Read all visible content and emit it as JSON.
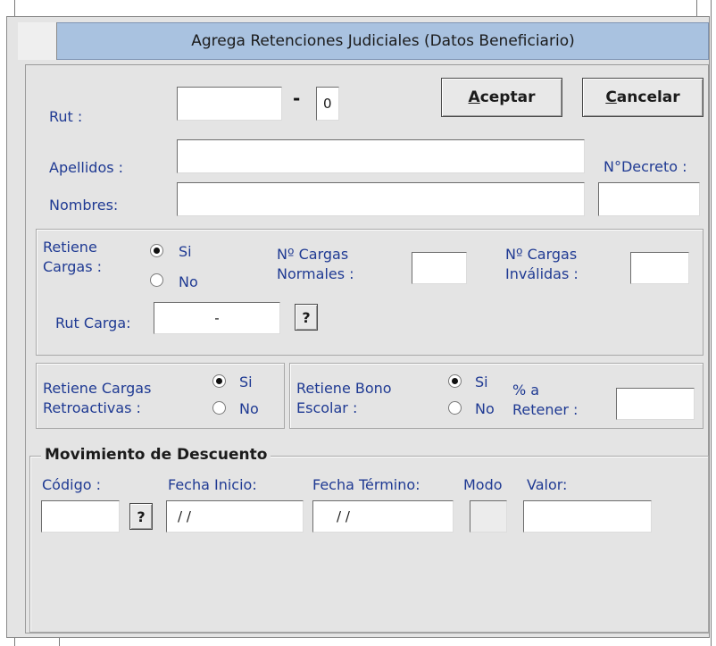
{
  "window": {
    "title": "Agrega Retenciones Judiciales (Datos Beneficiario)"
  },
  "form": {
    "rut_label": "Rut :",
    "rut_value": "",
    "rut_dash": "-",
    "rut_dv": "0",
    "apellidos_label": "Apellidos :",
    "apellidos_value": "",
    "nombres_label": "Nombres:",
    "nombres_value": "",
    "decreto_label": "N°Decreto :",
    "decreto_value": ""
  },
  "buttons": {
    "aceptar_mnemonic": "A",
    "aceptar_rest": "ceptar",
    "cancelar_mnemonic": "C",
    "cancelar_rest": "ancelar",
    "help": "?"
  },
  "cargas": {
    "retiene_label_1": "Retiene",
    "retiene_label_2": "Cargas :",
    "si_label": "Si",
    "no_label": "No",
    "normales_label_1": "Nº Cargas",
    "normales_label_2": "Normales :",
    "normales_value": "",
    "invalidas_label_1": "Nº Cargas",
    "invalidas_label_2": "Inválidas :",
    "invalidas_value": "",
    "rut_carga_label": "Rut Carga:",
    "rut_carga_value": "-"
  },
  "retroactivas": {
    "label_1": "Retiene Cargas",
    "label_2": "Retroactivas :",
    "si_label": "Si",
    "no_label": "No"
  },
  "bono": {
    "label_1": "Retiene Bono",
    "label_2": "Escolar  :",
    "si_label": "Si",
    "no_label": "No",
    "pct_label_1": "% a",
    "pct_label_2": "Retener :",
    "pct_value": ""
  },
  "movimiento": {
    "legend": "Movimiento de Descuento",
    "codigo_label": "Código :",
    "codigo_value": "",
    "fecha_inicio_label": "Fecha Inicio:",
    "fecha_inicio_value": "/ /",
    "fecha_termino_label": "Fecha Término:",
    "fecha_termino_value": "/ /",
    "modo_label": "Modo",
    "valor_label": "Valor:",
    "valor_value": ""
  }
}
